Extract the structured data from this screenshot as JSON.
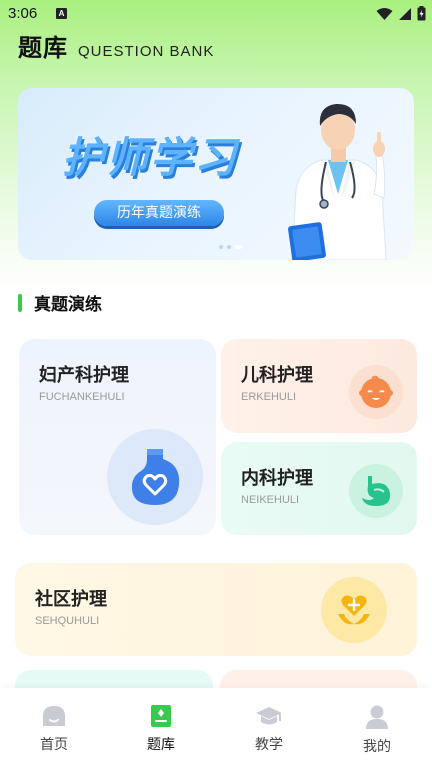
{
  "status_bar": {
    "time": "3:06",
    "notif_letter": "A"
  },
  "header": {
    "title": "题库",
    "subtitle": "QUESTION BANK"
  },
  "banner": {
    "headline": "护师学习",
    "pill": "历年真题演练",
    "page_count": 3,
    "active_page": 3
  },
  "section": {
    "title": "真题演练"
  },
  "cards": {
    "fuchan": {
      "name": "妇产科护理",
      "pinyin": "FUCHANKEHULI"
    },
    "erke": {
      "name": "儿科护理",
      "pinyin": "ERKEHULI"
    },
    "neike": {
      "name": "内科护理",
      "pinyin": "NEIKEHULI"
    },
    "shequ": {
      "name": "社区护理",
      "pinyin": "SEHQUHULI"
    }
  },
  "nav": {
    "items": [
      {
        "label": "首页",
        "icon": "home-icon"
      },
      {
        "label": "题库",
        "icon": "question-bank-icon"
      },
      {
        "label": "教学",
        "icon": "graduation-cap-icon"
      },
      {
        "label": "我的",
        "icon": "profile-icon"
      }
    ],
    "active_index": 1
  },
  "colors": {
    "accent_green": "#38c94e",
    "banner_blue": "#5eb3ff"
  }
}
